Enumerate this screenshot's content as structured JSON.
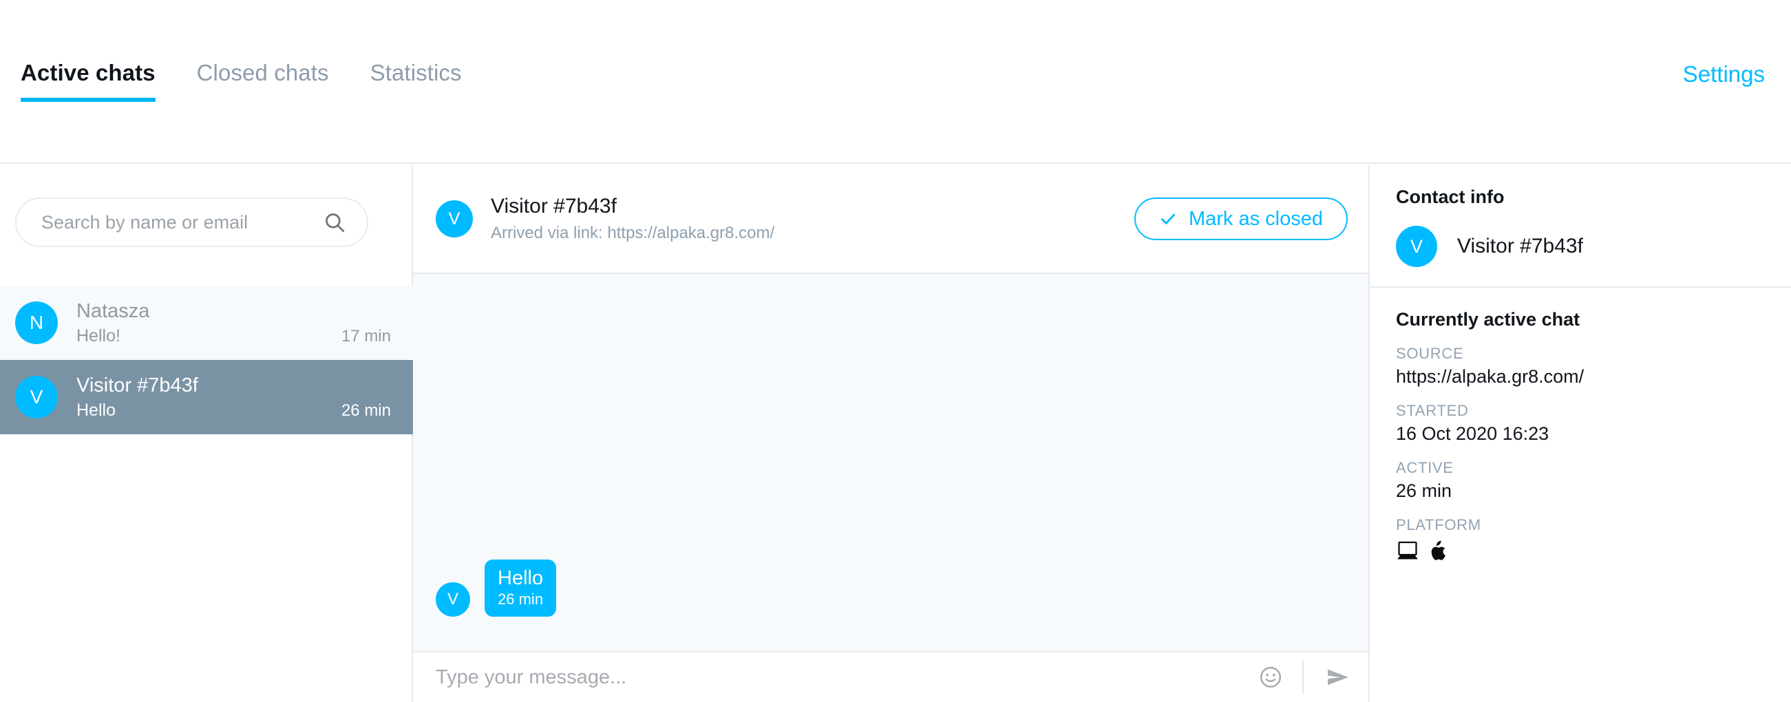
{
  "nav": {
    "tabs": [
      {
        "label": "Active chats",
        "active": true
      },
      {
        "label": "Closed chats",
        "active": false
      },
      {
        "label": "Statistics",
        "active": false
      }
    ],
    "settings_label": "Settings"
  },
  "sidebar": {
    "search": {
      "placeholder": "Search by name or email",
      "value": "",
      "icon": "search-icon"
    },
    "chats": [
      {
        "avatar_initial": "N",
        "name": "Natasza",
        "snippet": "Hello!",
        "time": "17 min",
        "selected": false
      },
      {
        "avatar_initial": "V",
        "name": "Visitor #7b43f",
        "snippet": "Hello",
        "time": "26 min",
        "selected": true
      }
    ]
  },
  "conversation": {
    "header": {
      "avatar_initial": "V",
      "title": "Visitor #7b43f",
      "subtitle": "Arrived via link: https://alpaka.gr8.com/",
      "mark_closed_label": "Mark as closed",
      "mark_closed_icon": "check-icon"
    },
    "messages": [
      {
        "avatar_initial": "V",
        "text": "Hello",
        "time": "26 min",
        "side": "incoming"
      }
    ],
    "composer": {
      "placeholder": "Type your message...",
      "value": "",
      "emoji_icon": "emoji-smiley-icon",
      "send_icon": "send-arrow-icon"
    }
  },
  "info_panel": {
    "contact": {
      "heading": "Contact info",
      "avatar_initial": "V",
      "name": "Visitor #7b43f"
    },
    "active_chat": {
      "heading": "Currently active chat",
      "fields": [
        {
          "label": "SOURCE",
          "value": "https://alpaka.gr8.com/"
        },
        {
          "label": "STARTED",
          "value": "16 Oct 2020 16:23"
        },
        {
          "label": "ACTIVE",
          "value": "26 min"
        }
      ],
      "platform": {
        "label": "PLATFORM",
        "icons": [
          "laptop-icon",
          "apple-logo-icon"
        ]
      }
    }
  },
  "colors": {
    "accent_cyan": "#00bbff",
    "tab_underline": "#00b6f0",
    "selected_row": "#7a93a4",
    "chat_bg": "#f7fafc",
    "border": "#e8eaed",
    "muted_text": "#9299a2",
    "label_text": "#93a3b3"
  }
}
